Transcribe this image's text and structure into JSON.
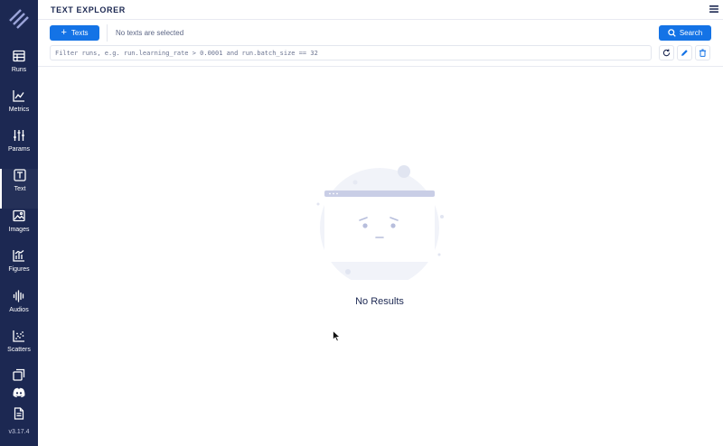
{
  "header": {
    "title": "TEXT EXPLORER"
  },
  "sidebar": {
    "items": [
      {
        "label": "Runs",
        "icon": "table-icon"
      },
      {
        "label": "Metrics",
        "icon": "line-chart-icon"
      },
      {
        "label": "Params",
        "icon": "sliders-icon"
      },
      {
        "label": "Text",
        "icon": "text-box-icon",
        "active": true
      },
      {
        "label": "Images",
        "icon": "image-icon"
      },
      {
        "label": "Figures",
        "icon": "bar-chart-icon"
      },
      {
        "label": "Audios",
        "icon": "audio-wave-icon"
      },
      {
        "label": "Scatters",
        "icon": "scatter-icon"
      }
    ],
    "version": "v3.17.4"
  },
  "toolbar": {
    "texts_button": "Texts",
    "selection_status": "No texts are selected",
    "search_button": "Search",
    "filter_placeholder": "Filter runs, e.g. run.learning_rate > 0.0001 and run.batch_size == 32"
  },
  "empty_state": {
    "message": "No Results"
  },
  "colors": {
    "sidebar": "#1c2852",
    "accent": "#1473e6",
    "border": "#e3e6ee"
  }
}
